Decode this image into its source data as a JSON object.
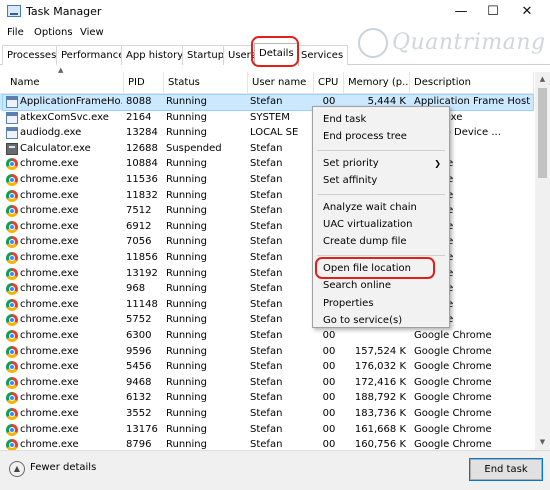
{
  "window": {
    "title": "Task Manager",
    "minimize_glyph": "—",
    "maximize_glyph": "☐",
    "close_glyph": "✕"
  },
  "menu": [
    "File",
    "Options",
    "View"
  ],
  "tabs": [
    "Processes",
    "Performance",
    "App history",
    "Startup",
    "Users",
    "Details",
    "Services"
  ],
  "active_tab": "Details",
  "watermark": "Quantrimang",
  "columns": [
    "Name",
    "PID",
    "Status",
    "User name",
    "CPU",
    "Memory (p...",
    "Description"
  ],
  "rows": [
    {
      "name": "ApplicationFrameHo...",
      "pid": "8088",
      "status": "Running",
      "user": "Stefan",
      "cpu": "00",
      "mem": "5,444 K",
      "desc": "Application Frame Host",
      "icon": "window-icon",
      "selected": true
    },
    {
      "name": "atkexComSvc.exe",
      "pid": "2164",
      "status": "Running",
      "user": "SYSTEM",
      "cpu": "",
      "mem": "",
      "desc": "mSvc.exe",
      "icon": "window-icon"
    },
    {
      "name": "audiodg.exe",
      "pid": "13284",
      "status": "Running",
      "user": "LOCAL SE",
      "cpu": "",
      "mem": "",
      "desc": "s Audio Device ...",
      "icon": "window-icon"
    },
    {
      "name": "Calculator.exe",
      "pid": "12688",
      "status": "Suspended",
      "user": "Stefan",
      "cpu": "",
      "mem": "",
      "desc": "tor.exe",
      "icon": "calculator-icon"
    },
    {
      "name": "chrome.exe",
      "pid": "10884",
      "status": "Running",
      "user": "Stefan",
      "cpu": "",
      "mem": "",
      "desc": "Chrome",
      "icon": "chrome-icon"
    },
    {
      "name": "chrome.exe",
      "pid": "11536",
      "status": "Running",
      "user": "Stefan",
      "cpu": "",
      "mem": "",
      "desc": "Chrome",
      "icon": "chrome-icon"
    },
    {
      "name": "chrome.exe",
      "pid": "11832",
      "status": "Running",
      "user": "Stefan",
      "cpu": "",
      "mem": "",
      "desc": "Chrome",
      "icon": "chrome-icon"
    },
    {
      "name": "chrome.exe",
      "pid": "7512",
      "status": "Running",
      "user": "Stefan",
      "cpu": "",
      "mem": "",
      "desc": "Chrome",
      "icon": "chrome-icon"
    },
    {
      "name": "chrome.exe",
      "pid": "6912",
      "status": "Running",
      "user": "Stefan",
      "cpu": "",
      "mem": "",
      "desc": "Chrome",
      "icon": "chrome-icon"
    },
    {
      "name": "chrome.exe",
      "pid": "7056",
      "status": "Running",
      "user": "Stefan",
      "cpu": "",
      "mem": "",
      "desc": "Chrome",
      "icon": "chrome-icon"
    },
    {
      "name": "chrome.exe",
      "pid": "11856",
      "status": "Running",
      "user": "Stefan",
      "cpu": "",
      "mem": "",
      "desc": "Chrome",
      "icon": "chrome-icon"
    },
    {
      "name": "chrome.exe",
      "pid": "13192",
      "status": "Running",
      "user": "Stefan",
      "cpu": "",
      "mem": "",
      "desc": "Chrome",
      "icon": "chrome-icon"
    },
    {
      "name": "chrome.exe",
      "pid": "968",
      "status": "Running",
      "user": "Stefan",
      "cpu": "",
      "mem": "",
      "desc": "Chrome",
      "icon": "chrome-icon"
    },
    {
      "name": "chrome.exe",
      "pid": "11148",
      "status": "Running",
      "user": "Stefan",
      "cpu": "",
      "mem": "",
      "desc": "Chrome",
      "icon": "chrome-icon"
    },
    {
      "name": "chrome.exe",
      "pid": "5752",
      "status": "Running",
      "user": "Stefan",
      "cpu": "",
      "mem": "",
      "desc": "Chrome",
      "icon": "chrome-icon"
    },
    {
      "name": "chrome.exe",
      "pid": "6300",
      "status": "Running",
      "user": "Stefan",
      "cpu": "00",
      "mem": "",
      "desc": "Google Chrome",
      "icon": "chrome-icon"
    },
    {
      "name": "chrome.exe",
      "pid": "9596",
      "status": "Running",
      "user": "Stefan",
      "cpu": "00",
      "mem": "157,524 K",
      "desc": "Google Chrome",
      "icon": "chrome-icon"
    },
    {
      "name": "chrome.exe",
      "pid": "5456",
      "status": "Running",
      "user": "Stefan",
      "cpu": "00",
      "mem": "176,032 K",
      "desc": "Google Chrome",
      "icon": "chrome-icon"
    },
    {
      "name": "chrome.exe",
      "pid": "9468",
      "status": "Running",
      "user": "Stefan",
      "cpu": "00",
      "mem": "172,416 K",
      "desc": "Google Chrome",
      "icon": "chrome-icon"
    },
    {
      "name": "chrome.exe",
      "pid": "6132",
      "status": "Running",
      "user": "Stefan",
      "cpu": "00",
      "mem": "188,792 K",
      "desc": "Google Chrome",
      "icon": "chrome-icon"
    },
    {
      "name": "chrome.exe",
      "pid": "3552",
      "status": "Running",
      "user": "Stefan",
      "cpu": "00",
      "mem": "183,736 K",
      "desc": "Google Chrome",
      "icon": "chrome-icon"
    },
    {
      "name": "chrome.exe",
      "pid": "13176",
      "status": "Running",
      "user": "Stefan",
      "cpu": "00",
      "mem": "161,668 K",
      "desc": "Google Chrome",
      "icon": "chrome-icon"
    },
    {
      "name": "chrome.exe",
      "pid": "8796",
      "status": "Running",
      "user": "Stefan",
      "cpu": "00",
      "mem": "160,756 K",
      "desc": "Google Chrome",
      "icon": "chrome-icon"
    }
  ],
  "context_menu": {
    "items": [
      {
        "label": "End task"
      },
      {
        "label": "End process tree"
      },
      {
        "sep": true
      },
      {
        "label": "Set priority",
        "submenu": true
      },
      {
        "label": "Set affinity"
      },
      {
        "sep": true
      },
      {
        "label": "Analyze wait chain"
      },
      {
        "label": "UAC virtualization"
      },
      {
        "label": "Create dump file"
      },
      {
        "sep": true
      },
      {
        "label": "Open file location",
        "highlighted": true
      },
      {
        "label": "Search online"
      },
      {
        "label": "Properties"
      },
      {
        "label": "Go to service(s)"
      }
    ]
  },
  "footer": {
    "fewer_details": "Fewer details",
    "end_task": "End task"
  },
  "colors": {
    "selection": "#cce8ff",
    "highlight_ring": "#e0201a"
  }
}
